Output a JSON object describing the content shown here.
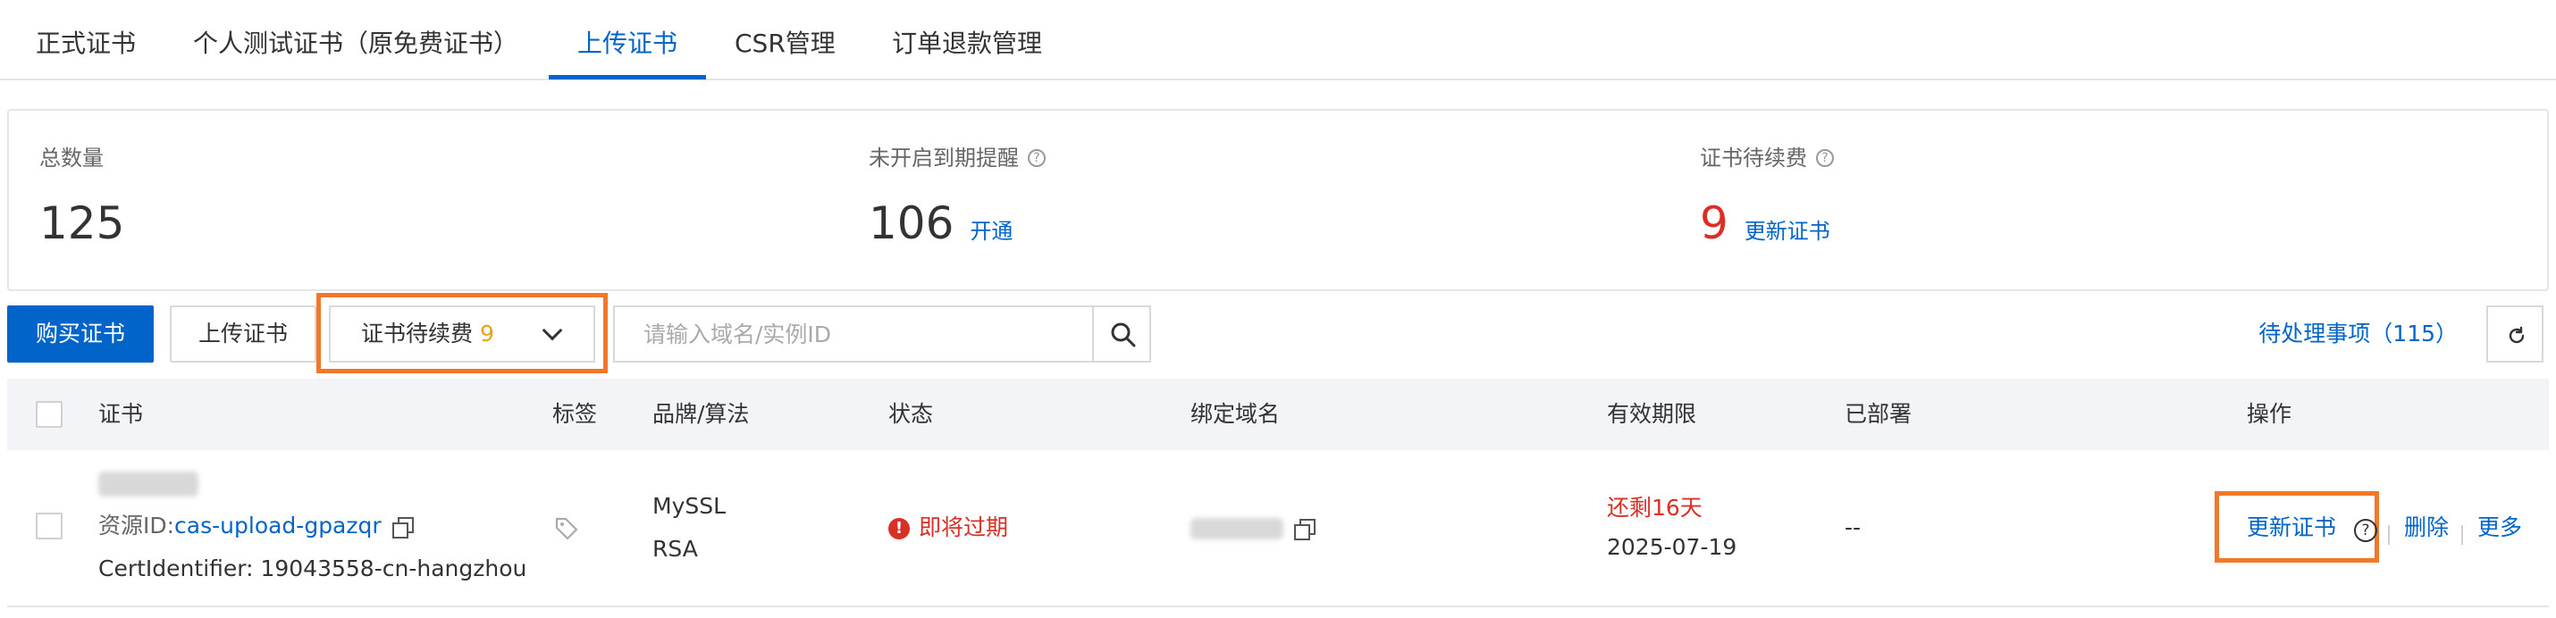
{
  "tabs": [
    {
      "label": "正式证书",
      "active": false
    },
    {
      "label": "个人测试证书（原免费证书）",
      "active": false
    },
    {
      "label": "上传证书",
      "active": true
    },
    {
      "label": "CSR管理",
      "active": false
    },
    {
      "label": "订单退款管理",
      "active": false
    }
  ],
  "summary": {
    "total": {
      "label": "总数量",
      "value": "125"
    },
    "reminder": {
      "label": "未开启到期提醒",
      "value": "106",
      "link": "开通"
    },
    "renewal": {
      "label": "证书待续费",
      "value": "9",
      "link": "更新证书"
    }
  },
  "toolbar": {
    "buy_label": "购买证书",
    "upload_label": "上传证书",
    "filter_label": "证书待续费",
    "filter_count": "9",
    "search_placeholder": "请输入域名/实例ID",
    "pending_label": "待处理事项（115）"
  },
  "table": {
    "headers": [
      "证书",
      "标签",
      "品牌/算法",
      "状态",
      "绑定域名",
      "有效期限",
      "已部署",
      "操作"
    ],
    "rows": [
      {
        "resource_prefix": "资源ID:",
        "resource_id": "cas-upload-gpazqr",
        "cert_identifier": "CertIdentifier: 19043558-cn-hangzhou",
        "brand": "MySSL",
        "algorithm": "RSA",
        "status": "即将过期",
        "remaining": "还剩16天",
        "expiry": "2025-07-19",
        "deployed": "--",
        "actions": {
          "renew": "更新证书",
          "delete": "删除",
          "more": "更多"
        }
      }
    ]
  },
  "colors": {
    "primary": "#0064c8",
    "danger": "#d93026",
    "highlight": "#f07828",
    "badge": "#e8a317"
  }
}
